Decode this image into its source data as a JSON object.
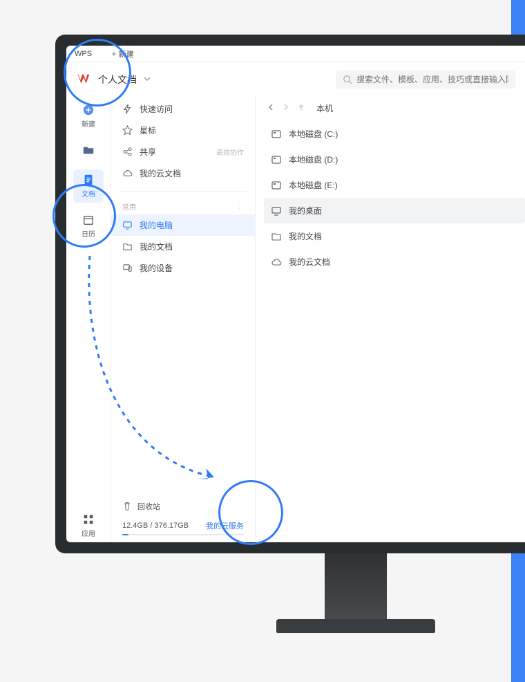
{
  "tabs": {
    "wps": "WPS",
    "new": "新建"
  },
  "title": {
    "text": "个人文档"
  },
  "search": {
    "placeholder": "搜索文件、模板、应用、技巧或直接输入网址…"
  },
  "rail": {
    "new": "新建",
    "open": "打开",
    "doc": "文档",
    "calendar": "日历",
    "apps": "应用"
  },
  "sidebar": {
    "quick": "快速访问",
    "star": "星标",
    "share": "共享",
    "share_tag": "高效协作",
    "cloud": "我的云文档",
    "common_heading": "常用",
    "my_pc": "我的电脑",
    "my_docs": "我的文档",
    "my_devices": "我的设备",
    "recycle": "回收站",
    "storage": "12.4GB / 376.17GB",
    "cloud_service": "我的云服务"
  },
  "breadcrumb": "本机",
  "files": {
    "disk_c": "本地磁盘 (C:)",
    "disk_d": "本地磁盘 (D:)",
    "disk_e": "本地磁盘 (E:)",
    "desktop": "我的桌面",
    "docs": "我的文档",
    "cloud": "我的云文档"
  }
}
